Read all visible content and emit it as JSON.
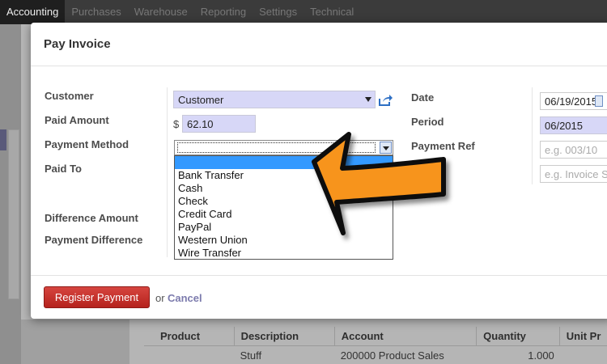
{
  "topbar": {
    "menu": [
      "Accounting",
      "Purchases",
      "Warehouse",
      "Reporting",
      "Settings",
      "Technical"
    ],
    "active": "Accounting"
  },
  "background_table": {
    "headers": [
      "Product",
      "Description",
      "Account",
      "Quantity",
      "Unit Pr"
    ],
    "rows": [
      [
        "",
        "Stuff",
        "200000 Product Sales",
        "1.000",
        ""
      ]
    ]
  },
  "modal": {
    "title": "Pay Invoice",
    "labels": {
      "customer": "Customer",
      "paid_amount": "Paid Amount",
      "payment_method": "Payment Method",
      "paid_to": "Paid To",
      "difference_amount": "Difference Amount",
      "payment_difference": "Payment Difference",
      "date": "Date",
      "period": "Period",
      "payment_ref": "Payment Ref"
    },
    "fields": {
      "customer": "Customer",
      "currency_symbol": "$",
      "paid_amount": "62.10",
      "payment_method": "",
      "date": "06/19/2015",
      "period": "06/2015",
      "payment_ref_placeholder": "e.g. 003/10",
      "memo_placeholder": "e.g. Invoice S"
    },
    "payment_method_options": [
      "",
      "Bank Transfer",
      "Cash",
      "Check",
      "Credit Card",
      "PayPal",
      "Western Union",
      "Wire Transfer"
    ],
    "footer": {
      "register_button": "Register Payment",
      "or": "or",
      "cancel": "Cancel"
    }
  },
  "colors": {
    "arrow_fill": "#f7941d",
    "arrow_stroke": "#111111",
    "primary_button": "#c7302a",
    "required_field": "#d7d7f7"
  }
}
